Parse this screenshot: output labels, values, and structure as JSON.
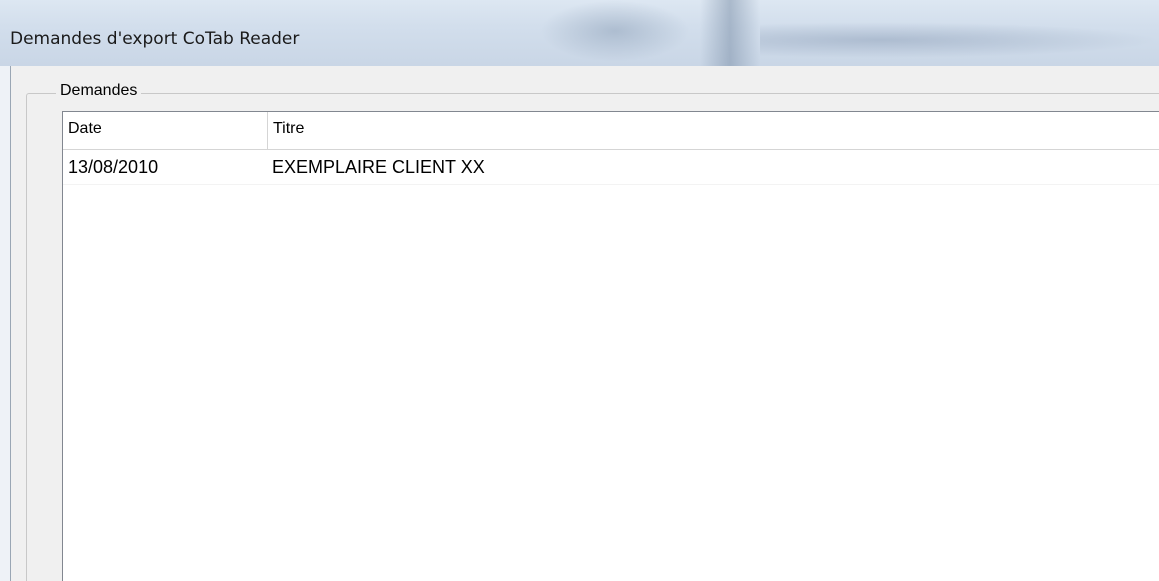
{
  "window": {
    "title": "Demandes d'export CoTab Reader"
  },
  "group": {
    "label": "Demandes"
  },
  "table": {
    "columns": [
      "Date",
      "Titre"
    ],
    "rows": [
      {
        "date": "13/08/2010",
        "titre": "EXEMPLAIRE CLIENT XX"
      }
    ]
  }
}
